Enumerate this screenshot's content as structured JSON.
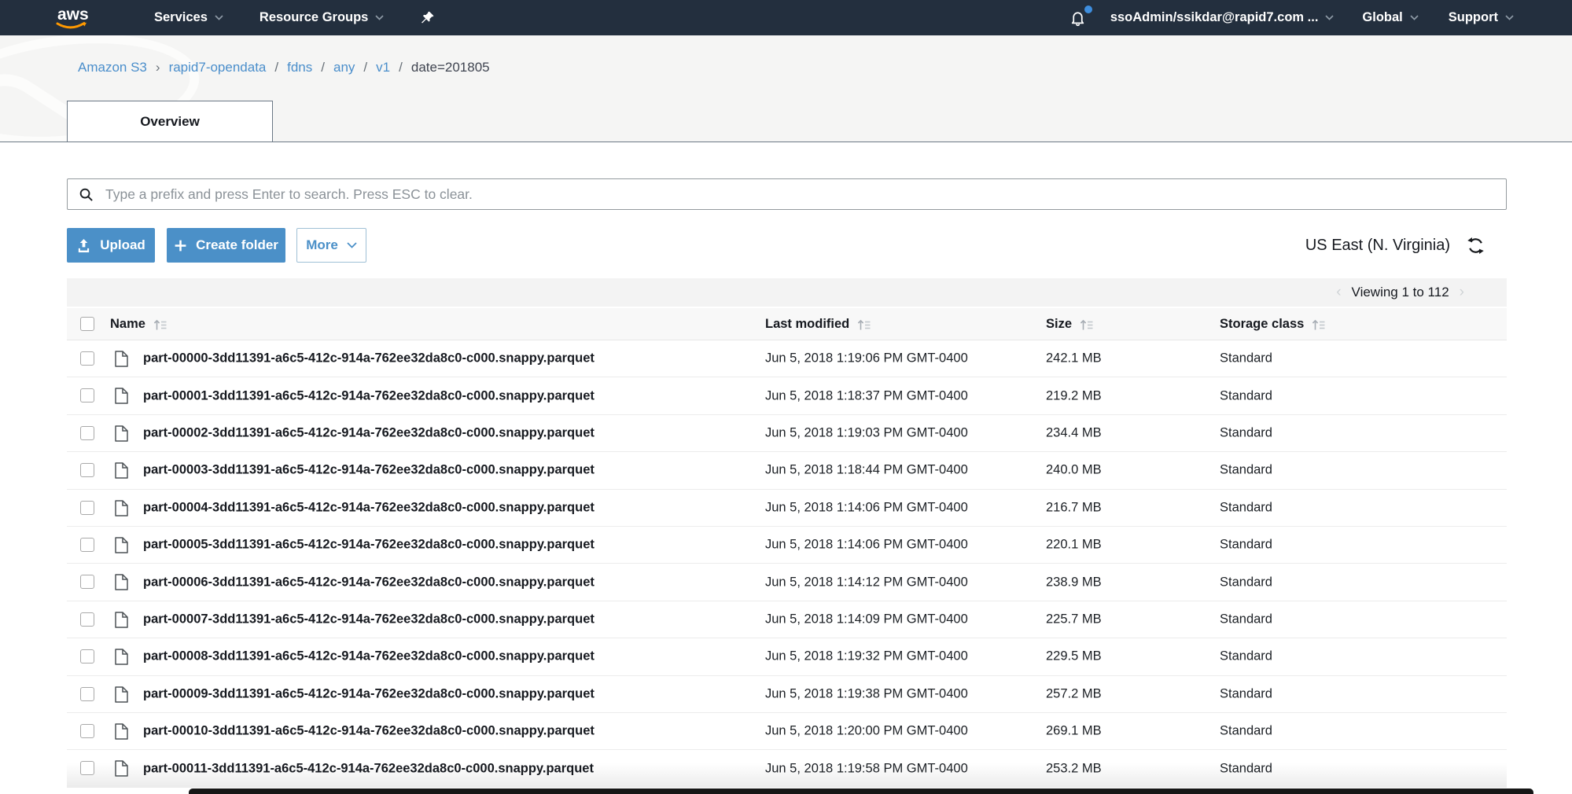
{
  "topnav": {
    "logo_text": "aws",
    "services_label": "Services",
    "resource_groups_label": "Resource Groups",
    "user_label": "ssoAdmin/ssikdar@rapid7.com ...",
    "global_label": "Global",
    "support_label": "Support"
  },
  "breadcrumb": {
    "root": "Amazon S3",
    "chevron": "›",
    "slash": "/",
    "parts": [
      "rapid7-opendata",
      "fdns",
      "any",
      "v1"
    ],
    "current": "date=201805"
  },
  "tab": {
    "overview_label": "Overview"
  },
  "search": {
    "placeholder": "Type a prefix and press Enter to search. Press ESC to clear."
  },
  "toolbar": {
    "upload_label": "Upload",
    "create_folder_label": "Create folder",
    "more_label": "More"
  },
  "region_selector": {
    "label": "US East (N. Virginia)"
  },
  "paging": {
    "text": "Viewing 1 to 112",
    "prev": "‹",
    "next": "›"
  },
  "table": {
    "columns": {
      "name": "Name",
      "modified": "Last modified",
      "size": "Size",
      "storage_class": "Storage class"
    },
    "rows": [
      {
        "name": "part-00000-3dd11391-a6c5-412c-914a-762ee32da8c0-c000.snappy.parquet",
        "modified": "Jun 5, 2018 1:19:06 PM GMT-0400",
        "size": "242.1 MB",
        "storage_class": "Standard"
      },
      {
        "name": "part-00001-3dd11391-a6c5-412c-914a-762ee32da8c0-c000.snappy.parquet",
        "modified": "Jun 5, 2018 1:18:37 PM GMT-0400",
        "size": "219.2 MB",
        "storage_class": "Standard"
      },
      {
        "name": "part-00002-3dd11391-a6c5-412c-914a-762ee32da8c0-c000.snappy.parquet",
        "modified": "Jun 5, 2018 1:19:03 PM GMT-0400",
        "size": "234.4 MB",
        "storage_class": "Standard"
      },
      {
        "name": "part-00003-3dd11391-a6c5-412c-914a-762ee32da8c0-c000.snappy.parquet",
        "modified": "Jun 5, 2018 1:18:44 PM GMT-0400",
        "size": "240.0 MB",
        "storage_class": "Standard"
      },
      {
        "name": "part-00004-3dd11391-a6c5-412c-914a-762ee32da8c0-c000.snappy.parquet",
        "modified": "Jun 5, 2018 1:14:06 PM GMT-0400",
        "size": "216.7 MB",
        "storage_class": "Standard"
      },
      {
        "name": "part-00005-3dd11391-a6c5-412c-914a-762ee32da8c0-c000.snappy.parquet",
        "modified": "Jun 5, 2018 1:14:06 PM GMT-0400",
        "size": "220.1 MB",
        "storage_class": "Standard"
      },
      {
        "name": "part-00006-3dd11391-a6c5-412c-914a-762ee32da8c0-c000.snappy.parquet",
        "modified": "Jun 5, 2018 1:14:12 PM GMT-0400",
        "size": "238.9 MB",
        "storage_class": "Standard"
      },
      {
        "name": "part-00007-3dd11391-a6c5-412c-914a-762ee32da8c0-c000.snappy.parquet",
        "modified": "Jun 5, 2018 1:14:09 PM GMT-0400",
        "size": "225.7 MB",
        "storage_class": "Standard"
      },
      {
        "name": "part-00008-3dd11391-a6c5-412c-914a-762ee32da8c0-c000.snappy.parquet",
        "modified": "Jun 5, 2018 1:19:32 PM GMT-0400",
        "size": "229.5 MB",
        "storage_class": "Standard"
      },
      {
        "name": "part-00009-3dd11391-a6c5-412c-914a-762ee32da8c0-c000.snappy.parquet",
        "modified": "Jun 5, 2018 1:19:38 PM GMT-0400",
        "size": "257.2 MB",
        "storage_class": "Standard"
      },
      {
        "name": "part-00010-3dd11391-a6c5-412c-914a-762ee32da8c0-c000.snappy.parquet",
        "modified": "Jun 5, 2018 1:20:00 PM GMT-0400",
        "size": "269.1 MB",
        "storage_class": "Standard"
      },
      {
        "name": "part-00011-3dd11391-a6c5-412c-914a-762ee32da8c0-c000.snappy.parquet",
        "modified": "Jun 5, 2018 1:19:58 PM GMT-0400",
        "size": "253.2 MB",
        "storage_class": "Standard"
      }
    ]
  },
  "colors": {
    "nav_bg": "#232f3e",
    "aws_orange": "#ff9900",
    "link_blue": "#4a8ecb",
    "button_blue": "#4b90c8",
    "notification_dot": "#3e8ede"
  }
}
